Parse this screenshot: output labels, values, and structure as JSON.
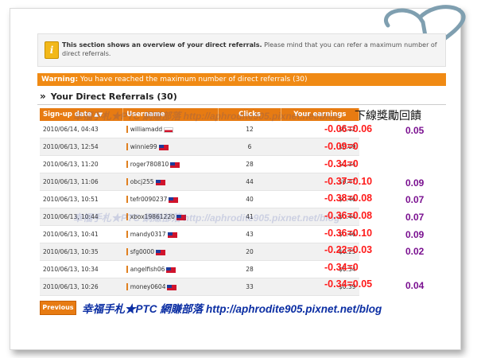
{
  "info": {
    "bold_text": "This section shows an overview of your direct referrals.",
    "rest_text": " Please mind that you can refer a maximum number of direct referrals."
  },
  "warning": {
    "label": "Warning:",
    "text": " You have reached the maximum number of direct referrals (30)"
  },
  "section_title": "Your Direct Referrals (30)",
  "table": {
    "headers": {
      "date": "Sign-up date",
      "user": "Username",
      "clicks": "Clicks",
      "earnings": "Your earnings"
    },
    "rows": [
      {
        "date": "2010/06/14, 04:43",
        "user": "williamadd",
        "flag": "pl",
        "clicks": "12",
        "earn": "$0.12"
      },
      {
        "date": "2010/06/13, 12:54",
        "user": "winnie99",
        "flag": "tw",
        "clicks": "6",
        "earn": "$0.09"
      },
      {
        "date": "2010/06/13, 11:20",
        "user": "roger780810",
        "flag": "tw",
        "clicks": "28",
        "earn": "$0.34"
      },
      {
        "date": "2010/06/13, 11:06",
        "user": "obcj255",
        "flag": "tw",
        "clicks": "44",
        "earn": "$0.47"
      },
      {
        "date": "2010/06/13, 10:51",
        "user": "tefr0090237",
        "flag": "tw",
        "clicks": "40",
        "earn": "$0.46"
      },
      {
        "date": "2010/06/13, 10:44",
        "user": "xbox19861220",
        "flag": "tw",
        "clicks": "41",
        "earn": "$0.44"
      },
      {
        "date": "2010/06/13, 10:41",
        "user": "mandy0317",
        "flag": "tw",
        "clicks": "43",
        "earn": "$0.46"
      },
      {
        "date": "2010/06/13, 10:35",
        "user": "sfg0000",
        "flag": "tw",
        "clicks": "20",
        "earn": "$0.25"
      },
      {
        "date": "2010/06/13, 10:34",
        "user": "angelfish06",
        "flag": "tw",
        "clicks": "28",
        "earn": "$0.34"
      },
      {
        "date": "2010/06/13, 10:26",
        "user": "money0604",
        "flag": "tw",
        "clicks": "33",
        "earn": "$0.39"
      }
    ]
  },
  "annotations": {
    "header_note": "下線獎勵回饋",
    "calcs": [
      "-0.06=0.06",
      "-0.09=0",
      "-0.34=0",
      "-0.37=0.10",
      "-0.38=0.08",
      "-0.36=0.08",
      "-0.36=0.10",
      "-0.22=0.03",
      "-0.34=0",
      "-0.34=0.05"
    ],
    "rewards": [
      "0.05",
      "",
      "",
      "0.09",
      "0.07",
      "0.07",
      "0.09",
      "0.02",
      "",
      "0.04"
    ]
  },
  "pagination": {
    "previous": "Previous"
  },
  "watermark": "幸福手札★PTC 網賺部落 http://aphrodite905.pixnet.net/blog",
  "ghost_watermark": "幸福手札★PTC 網賺部落 http://aphrodite905.pixnet.net/blog",
  "colors": {
    "accent": "#e77b12",
    "annotation_red": "#ff1a1a",
    "annotation_purple": "#7a1090",
    "watermark_blue": "#0b2ea3"
  }
}
